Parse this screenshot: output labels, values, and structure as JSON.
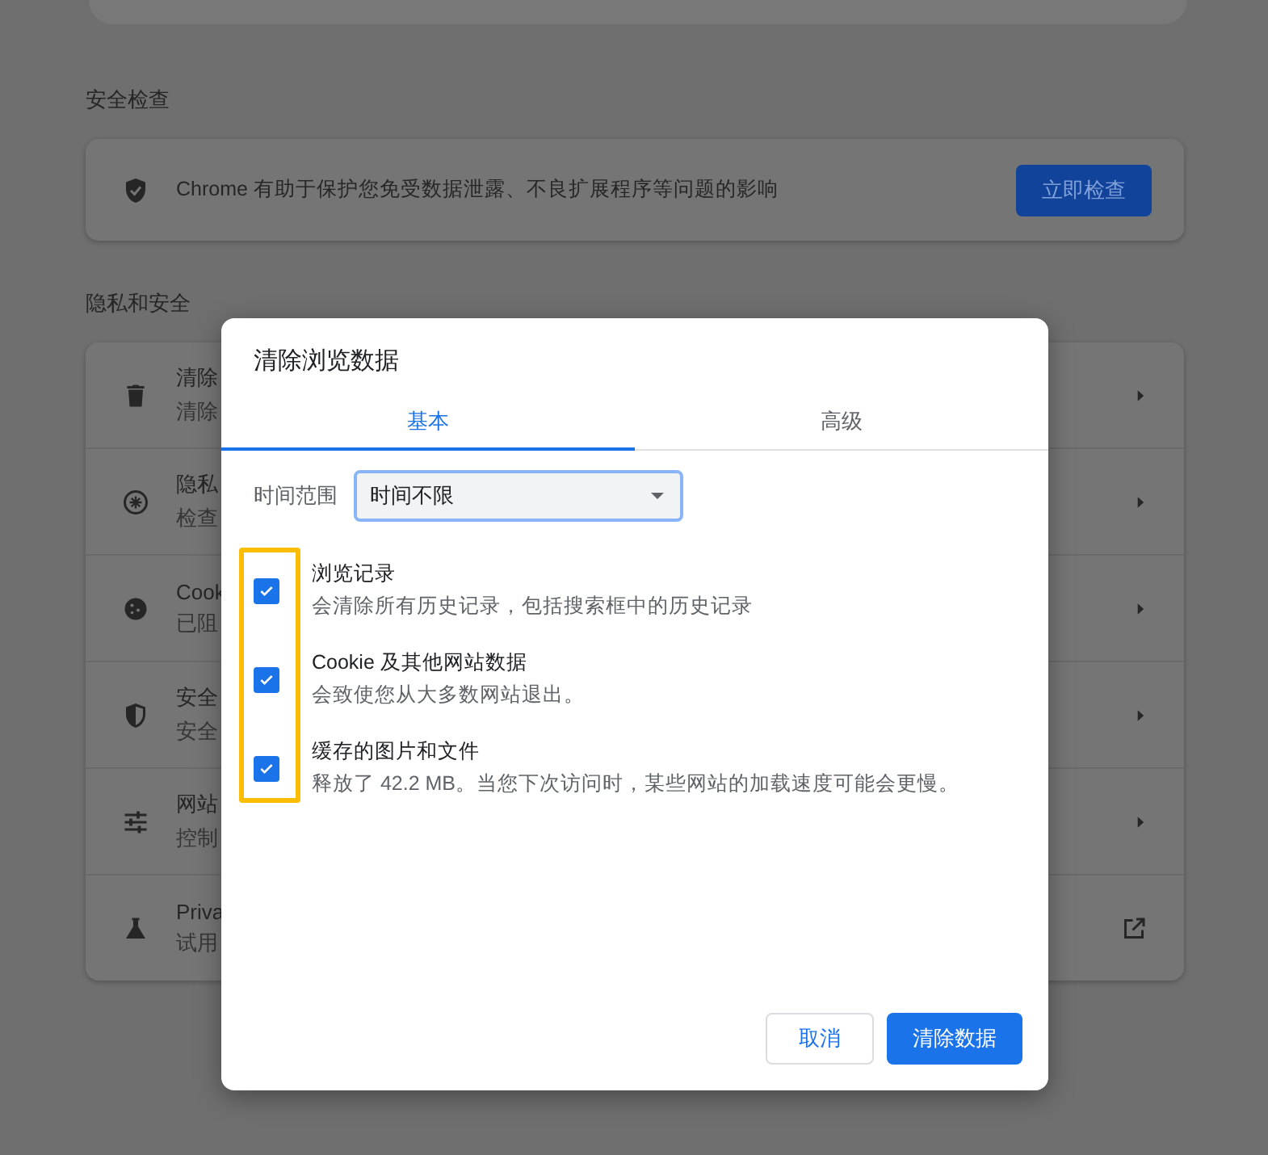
{
  "safety_check": {
    "heading": "安全检查",
    "description": "Chrome 有助于保护您免受数据泄露、不良扩展程序等问题的影响",
    "button": "立即检查"
  },
  "privacy": {
    "heading": "隐私和安全",
    "rows": [
      {
        "title": "清除",
        "subtitle": "清除",
        "kind": "subpage"
      },
      {
        "title": "隐私",
        "subtitle": "检查",
        "kind": "subpage"
      },
      {
        "title": "Cook",
        "subtitle": "已阻",
        "kind": "subpage"
      },
      {
        "title": "安全",
        "subtitle": "安全",
        "kind": "subpage"
      },
      {
        "title": "网站",
        "subtitle": "控制",
        "kind": "subpage"
      },
      {
        "title": "Priva",
        "subtitle": "试用",
        "kind": "external"
      }
    ]
  },
  "dialog": {
    "title": "清除浏览数据",
    "tabs": [
      {
        "label": "基本",
        "selected": true
      },
      {
        "label": "高级",
        "selected": false
      }
    ],
    "time_range": {
      "label": "时间范围",
      "value": "时间不限"
    },
    "options": [
      {
        "title": "浏览记录",
        "description": "会清除所有历史记录，包括搜索框中的历史记录",
        "checked": true
      },
      {
        "title": "Cookie 及其他网站数据",
        "description": "会致使您从大多数网站退出。",
        "checked": true
      },
      {
        "title": "缓存的图片和文件",
        "description": "释放了 42.2 MB。当您下次访问时，某些网站的加载速度可能会更慢。",
        "checked": true
      }
    ],
    "buttons": [
      {
        "label": "取消",
        "kind": "secondary"
      },
      {
        "label": "清除数据",
        "kind": "primary"
      }
    ]
  }
}
